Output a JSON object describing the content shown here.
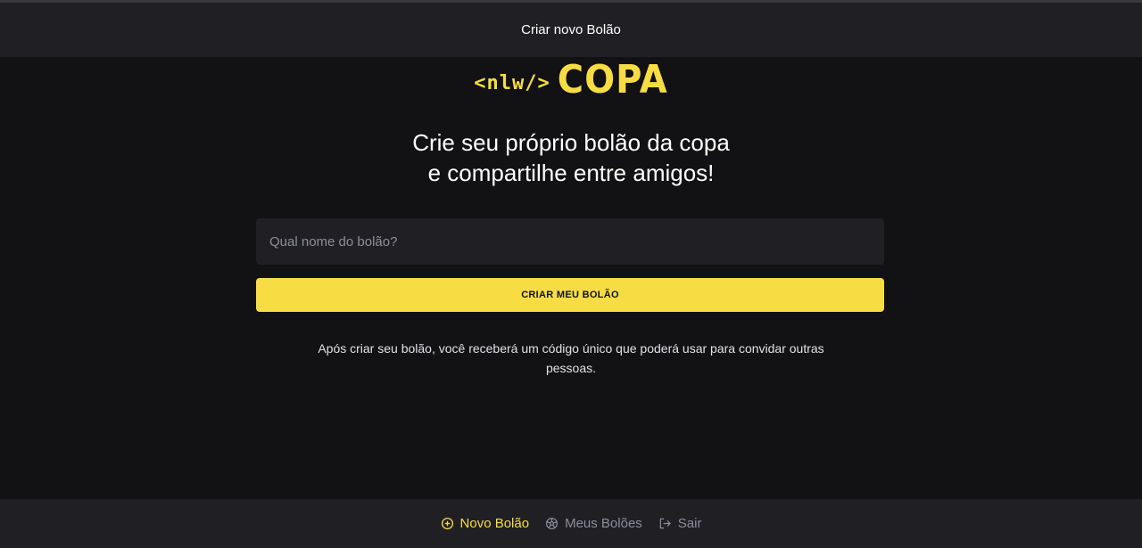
{
  "header": {
    "title": "Criar novo Bolão"
  },
  "logo": {
    "tag": "<nlw/>",
    "word": "COPA"
  },
  "headline": {
    "line1": "Crie seu próprio bolão da copa",
    "line2": "e compartilhe entre amigos!"
  },
  "form": {
    "name_placeholder": "Qual nome do bolão?",
    "name_value": "",
    "submit_label": "CRIAR MEU BOLÃO"
  },
  "info": {
    "text": "Após criar seu bolão, você receberá um código único que poderá usar para convidar outras pessoas."
  },
  "bottom_nav": {
    "items": [
      {
        "label": "Novo Bolão",
        "icon": "plus-circle-icon",
        "active": true
      },
      {
        "label": "Meus Bolões",
        "icon": "soccer-ball-icon",
        "active": false
      },
      {
        "label": "Sair",
        "icon": "sign-out-icon",
        "active": false
      }
    ]
  },
  "colors": {
    "background": "#121214",
    "surface": "#202024",
    "accent": "#F7DD43",
    "muted": "#8D8D99",
    "text": "#FFFFFF"
  }
}
